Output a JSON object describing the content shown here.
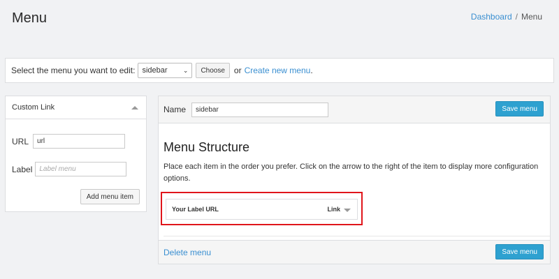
{
  "header": {
    "title": "Menu",
    "breadcrumb": {
      "link": "Dashboard",
      "separator": "/",
      "current": "Menu"
    }
  },
  "select_bar": {
    "label": "Select the menu you want to edit:",
    "selected_menu": "sidebar",
    "choose_label": "Choose",
    "or_text": "or",
    "create_link": "Create new menu",
    "period": "."
  },
  "custom_link": {
    "title": "Custom Link",
    "url_label": "URL",
    "url_value": "url",
    "label_label": "Label",
    "label_placeholder": "Label menu",
    "add_button": "Add menu item"
  },
  "menu_panel": {
    "name_label": "Name",
    "name_value": "sidebar",
    "save_label": "Save menu",
    "structure_title": "Menu Structure",
    "structure_desc": "Place each item in the order you prefer. Click on the arrow to the right of the item to display more configuration options.",
    "items": [
      {
        "label": "Your Label URL",
        "type": "Link"
      }
    ],
    "delete_link": "Delete menu",
    "footer_save_label": "Save menu"
  },
  "colors": {
    "accent": "#2ea1d0",
    "link": "#3a8fd1",
    "highlight": "#e0151b",
    "background": "#f1f2f4"
  }
}
